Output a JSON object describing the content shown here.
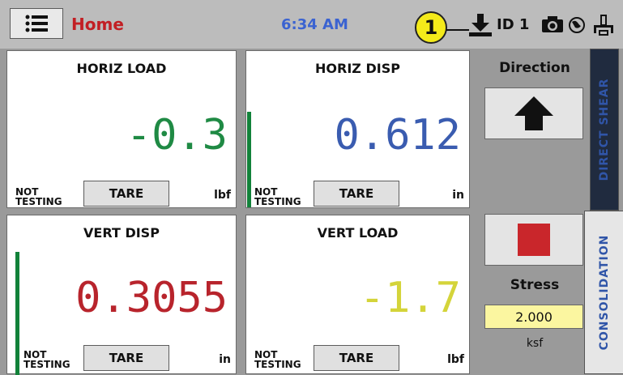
{
  "header": {
    "title": "Home",
    "time": "6:34 AM",
    "callout_number": "1",
    "id_label": "ID 1"
  },
  "panels": [
    {
      "title": "HORIZ LOAD",
      "value": "-0.3",
      "value_color": "#1f8a44",
      "status_line1": "NOT",
      "status_line2": "TESTING",
      "tare_label": "TARE",
      "unit": "lbf",
      "active_bar": false
    },
    {
      "title": "HORIZ DISP",
      "value": "0.612",
      "value_color": "#3a5cb0",
      "status_line1": "NOT",
      "status_line2": "TESTING",
      "tare_label": "TARE",
      "unit": "in",
      "active_bar": true
    },
    {
      "title": "VERT DISP",
      "value": "0.3055",
      "value_color": "#b8242c",
      "status_line1": "NOT",
      "status_line2": "TESTING",
      "tare_label": "TARE",
      "unit": "in",
      "active_bar": true
    },
    {
      "title": "VERT LOAD",
      "value": "-1.7",
      "value_color": "#d4d43a",
      "status_line1": "NOT",
      "status_line2": "TESTING",
      "tare_label": "TARE",
      "unit": "lbf",
      "active_bar": false
    }
  ],
  "direct_shear": {
    "tab_label": "DIRECT SHEAR",
    "direction_label": "Direction",
    "direction_icon": "up-arrow-icon"
  },
  "consolidation": {
    "tab_label": "CONSOLIDATION",
    "stop_icon": "stop-icon",
    "stress_label": "Stress",
    "stress_value": "2.000",
    "stress_unit": "ksf"
  },
  "icons": [
    "menu-icon",
    "download-icon",
    "camera-icon",
    "globe-icon",
    "usb-icon"
  ],
  "colors": {
    "title_red": "#c21f24",
    "time_blue": "#3b63d1",
    "callout_yellow": "#f4ea1a",
    "active_green": "#12823a",
    "tab_blue": "#3055a8",
    "stop_red": "#c9262b",
    "stress_field": "#fbf6a0"
  }
}
